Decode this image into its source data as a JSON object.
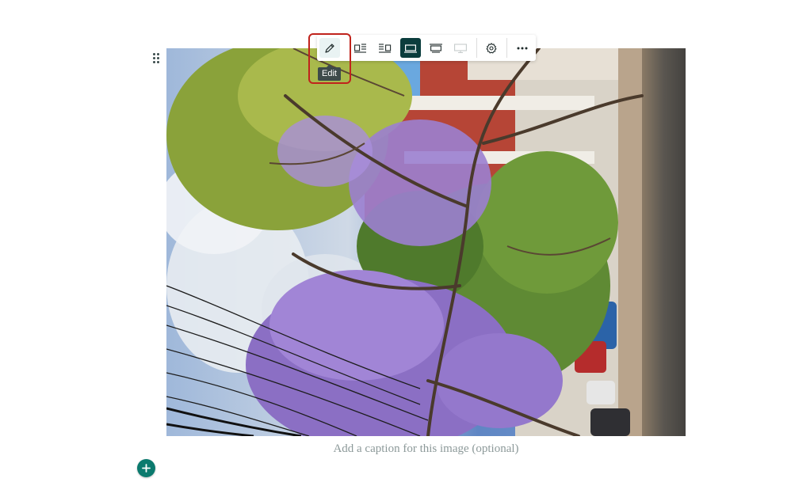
{
  "toolbar": {
    "tooltip": "Edit",
    "buttons": [
      {
        "name": "edit",
        "icon": "pencil-icon",
        "state": "hover"
      },
      {
        "name": "align-left",
        "icon": "image-left-text-icon",
        "state": "default"
      },
      {
        "name": "align-right",
        "icon": "image-right-text-icon",
        "state": "default"
      },
      {
        "name": "width-regular",
        "icon": "image-regular-width-icon",
        "state": "active"
      },
      {
        "name": "width-wide",
        "icon": "image-wide-icon",
        "state": "default"
      },
      {
        "name": "width-full",
        "icon": "image-full-width-icon",
        "state": "disabled"
      },
      {
        "name": "settings",
        "icon": "gear-icon",
        "state": "default"
      },
      {
        "name": "more",
        "icon": "more-horizontal-icon",
        "state": "default"
      }
    ]
  },
  "image": {
    "description_icon": "photo-image"
  },
  "caption": {
    "placeholder": "Add a caption for this image (optional)"
  },
  "add_block": {
    "icon": "plus-icon"
  },
  "colors": {
    "accent": "#0b3d3d",
    "add_button": "#0b7a6e",
    "highlight": "#c0231c",
    "caption_text": "#8c9999"
  }
}
